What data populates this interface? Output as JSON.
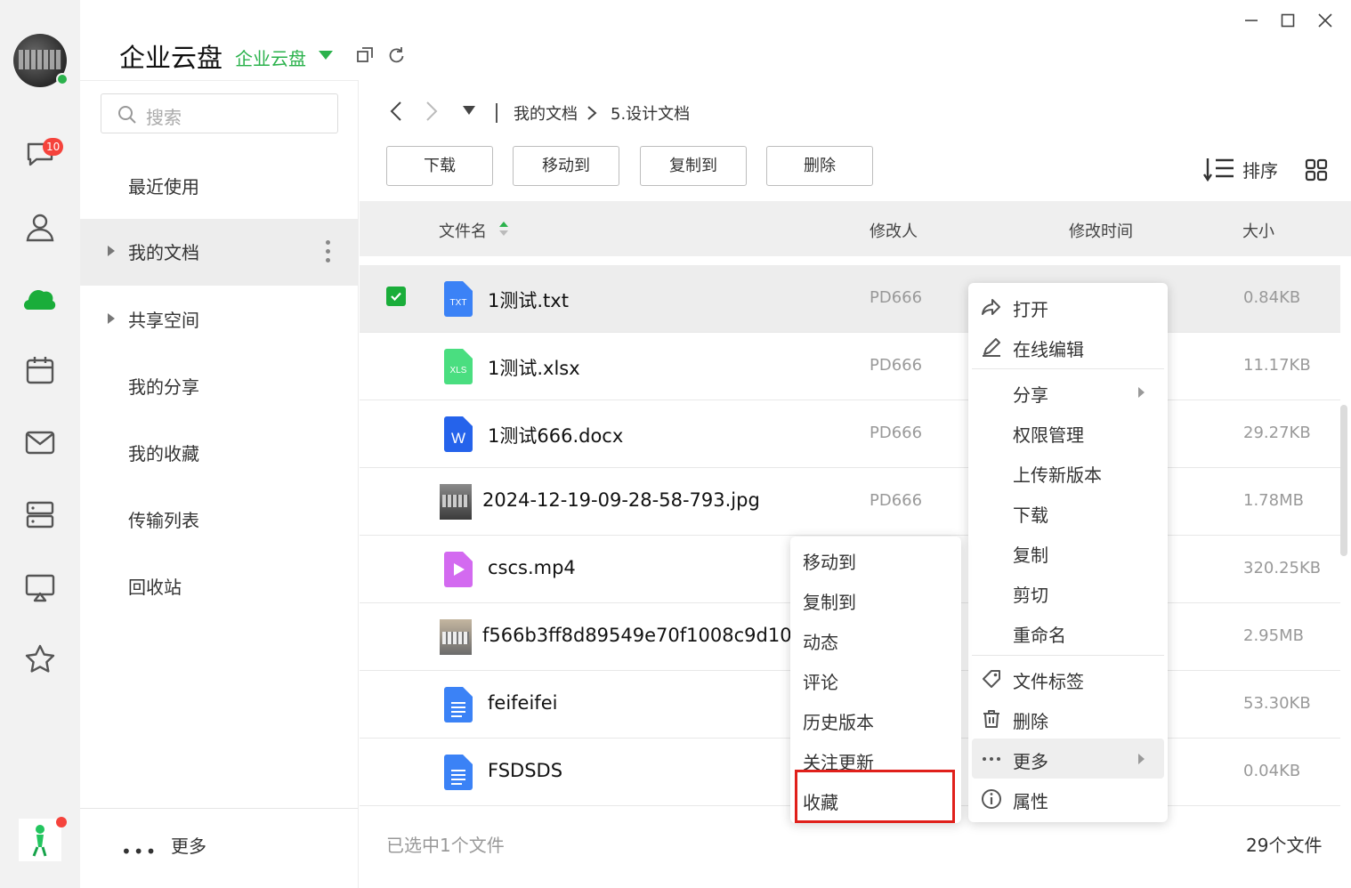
{
  "app": {
    "title": "企业云盘",
    "space_name": "企业云盘"
  },
  "rail": {
    "badge_count": "10"
  },
  "search": {
    "placeholder": "搜索"
  },
  "nav": {
    "items": [
      {
        "label": "最近使用"
      },
      {
        "label": "我的文档"
      },
      {
        "label": "共享空间"
      },
      {
        "label": "我的分享"
      },
      {
        "label": "我的收藏"
      },
      {
        "label": "传输列表"
      },
      {
        "label": "回收站"
      }
    ],
    "more_label": "更多"
  },
  "breadcrumb": {
    "items": [
      "我的文档",
      "5.设计文档"
    ]
  },
  "toolbar": {
    "download": "下载",
    "move_to": "移动到",
    "copy_to": "复制到",
    "delete": "删除",
    "sort": "排序"
  },
  "table": {
    "headers": {
      "name": "文件名",
      "modifier": "修改人",
      "modified_time": "修改时间",
      "size": "大小"
    },
    "rows": [
      {
        "name": "1测试.txt",
        "modifier": "PD666",
        "size": "0.84KB",
        "type": "txt",
        "selected": true
      },
      {
        "name": "1测试.xlsx",
        "modifier": "PD666",
        "size": "11.17KB",
        "type": "xlsx"
      },
      {
        "name": "1测试666.docx",
        "modifier": "PD666",
        "size": "29.27KB",
        "type": "docx"
      },
      {
        "name": "2024-12-19-09-28-58-793.jpg",
        "modifier": "PD666",
        "size": "1.78MB",
        "type": "image"
      },
      {
        "name": "cscs.mp4",
        "modifier": "",
        "size": "320.25KB",
        "type": "video"
      },
      {
        "name": "f566b3ff8d89549e70f1008c9d10...",
        "modifier": "",
        "size": "2.95MB",
        "type": "image"
      },
      {
        "name": "feifeifei",
        "modifier": "",
        "size": "53.30KB",
        "type": "doc"
      },
      {
        "name": "FSDSDS",
        "modifier": "",
        "size": "0.04KB",
        "type": "doc"
      }
    ]
  },
  "footer": {
    "selected_text": "已选中1个文件",
    "total_text": "29个文件"
  },
  "context_menu": {
    "items": [
      "打开",
      "在线编辑",
      "分享",
      "权限管理",
      "上传新版本",
      "下载",
      "复制",
      "剪切",
      "重命名",
      "文件标签",
      "删除",
      "更多",
      "属性"
    ]
  },
  "submenu": {
    "items": [
      "移动到",
      "复制到",
      "动态",
      "评论",
      "历史版本",
      "关注更新",
      "收藏"
    ]
  },
  "colors": {
    "accent": "#2bb24c",
    "checkbox": "#1aad3a",
    "highlight_box": "#e0201b",
    "badge": "#f5433c"
  }
}
